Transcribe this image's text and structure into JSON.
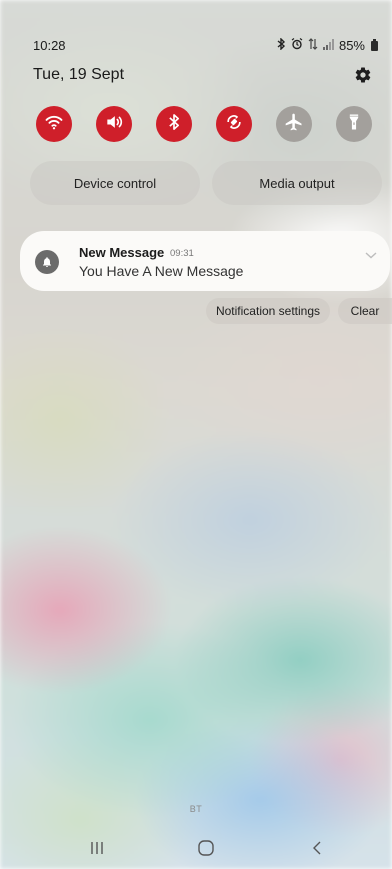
{
  "status_bar": {
    "time": "10:28",
    "battery": "85%",
    "icons": [
      "bluetooth-icon",
      "alarm-icon",
      "data-icon",
      "signal-icon",
      "battery-icon"
    ]
  },
  "header": {
    "date": "Tue, 19 Sept",
    "settings_icon": "gear-icon"
  },
  "quick_settings": {
    "tiles": [
      {
        "name": "wifi",
        "icon": "wifi-icon",
        "state": "on"
      },
      {
        "name": "sound",
        "icon": "volume-icon",
        "state": "on"
      },
      {
        "name": "bluetooth",
        "icon": "bluetooth-icon",
        "state": "on"
      },
      {
        "name": "auto-rotate",
        "icon": "rotate-icon",
        "state": "on"
      },
      {
        "name": "airplane-mode",
        "icon": "airplane-icon",
        "state": "off"
      },
      {
        "name": "flashlight",
        "icon": "flashlight-icon",
        "state": "off"
      }
    ],
    "active_color": "#cf1f2a",
    "inactive_color": "#a3a09c",
    "device_control_label": "Device control",
    "media_output_label": "Media output"
  },
  "notification": {
    "title": "New Message",
    "time": "09:31",
    "body": "You Have A New Message",
    "icon": "bell-icon"
  },
  "notification_actions": {
    "settings_label": "Notification settings",
    "clear_label": "Clear"
  },
  "carrier_label": "BT",
  "nav_bar": {
    "recents_icon": "recents-icon",
    "home_icon": "home-icon",
    "back_icon": "back-icon"
  }
}
